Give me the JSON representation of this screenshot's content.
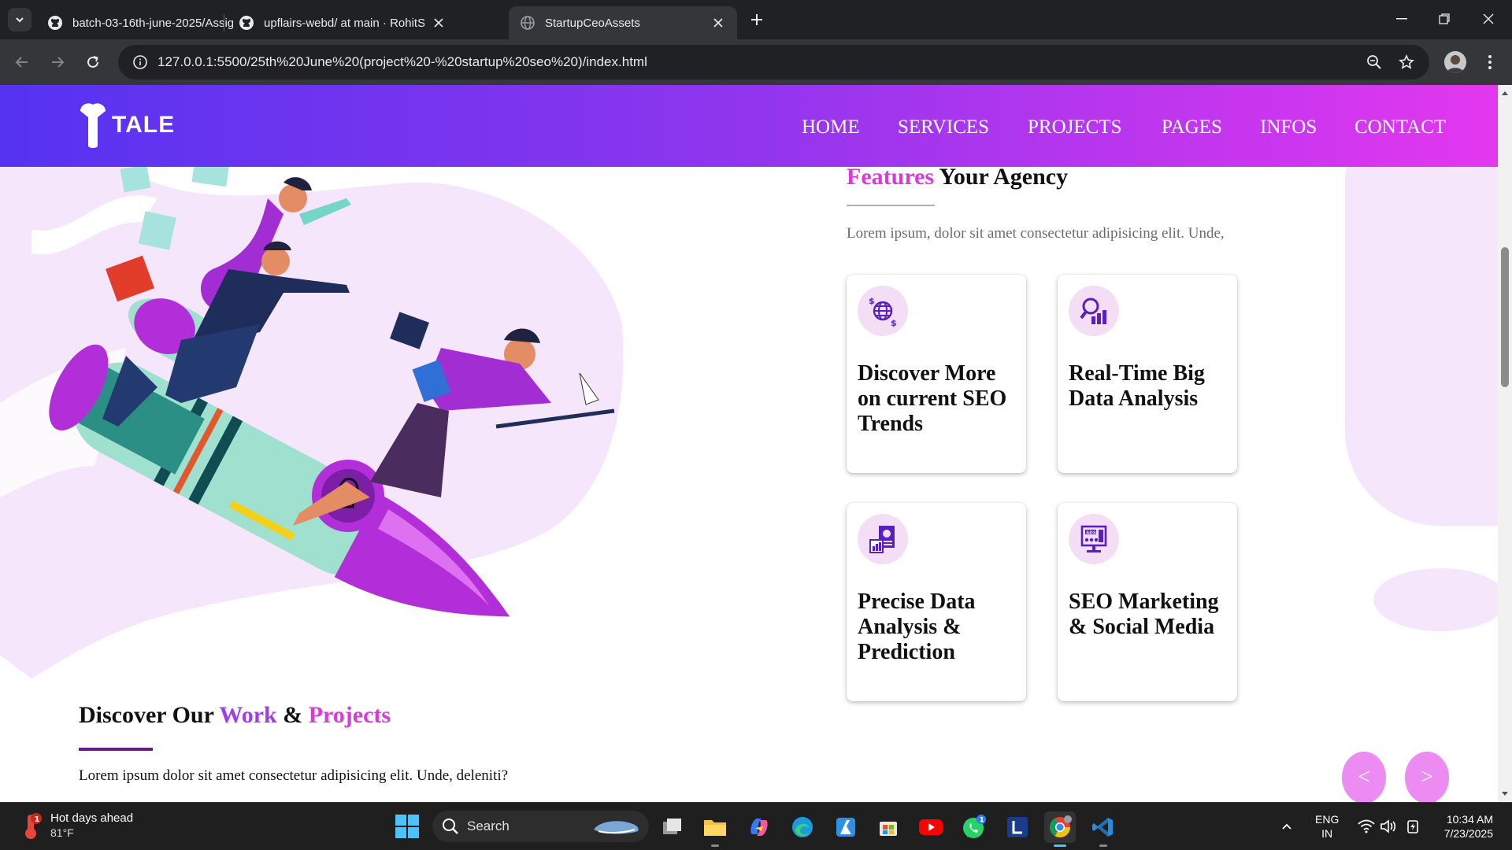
{
  "browser": {
    "tabs": [
      {
        "title": "batch-03-16th-june-2025/Assig",
        "favicon": "github-icon",
        "active": false
      },
      {
        "title": "upflairs-webd/ at main · RohitS",
        "favicon": "github-icon",
        "active": false
      },
      {
        "title": "StartupCeoAssets",
        "favicon": "globe-icon",
        "active": true
      }
    ],
    "url": "127.0.0.1:5500/25th%20June%20(project%20-%20startup%20seo%20)/index.html"
  },
  "site": {
    "logo_text": "TALE",
    "nav": [
      "HOME",
      "SERVICES",
      "PROJECTS",
      "PAGES",
      "INFOS",
      "CONTACT"
    ],
    "features": {
      "title_accent": "Features",
      "title_rest": " Your Agency",
      "description": "Lorem ipsum, dolor sit amet consectetur adipisicing elit. Unde,",
      "cards": [
        {
          "title": "Discover More on current SEO Trends",
          "icon": "globe-dollar-icon"
        },
        {
          "title": "Real-Time Big Data Analysis",
          "icon": "magnifier-chart-icon"
        },
        {
          "title": "Precise Data Analysis & Prediction",
          "icon": "report-chart-icon"
        },
        {
          "title": "SEO Marketing & Social Media",
          "icon": "ads-monitor-icon"
        }
      ]
    },
    "projects": {
      "title_a": "Discover Our ",
      "title_work": "Work",
      "title_amp": " & ",
      "title_projects": "Projects",
      "description": "Lorem ipsum dolor sit amet consectetur adipisicing elit. Unde, deleniti?"
    },
    "slider": {
      "prev": "<",
      "next": ">"
    },
    "colors": {
      "accent_pink": "#d93ad9",
      "accent_purple": "#a03ce8",
      "header_start": "#5533f0",
      "header_end": "#e237ef"
    }
  },
  "taskbar": {
    "weather_title": "Hot days ahead",
    "weather_temp": "81°F",
    "weather_badge": "1",
    "search_label": "Search",
    "whatsapp_badge": "1",
    "lang_line1": "ENG",
    "lang_line2": "IN",
    "time": "10:34 AM",
    "date": "7/23/2025"
  }
}
